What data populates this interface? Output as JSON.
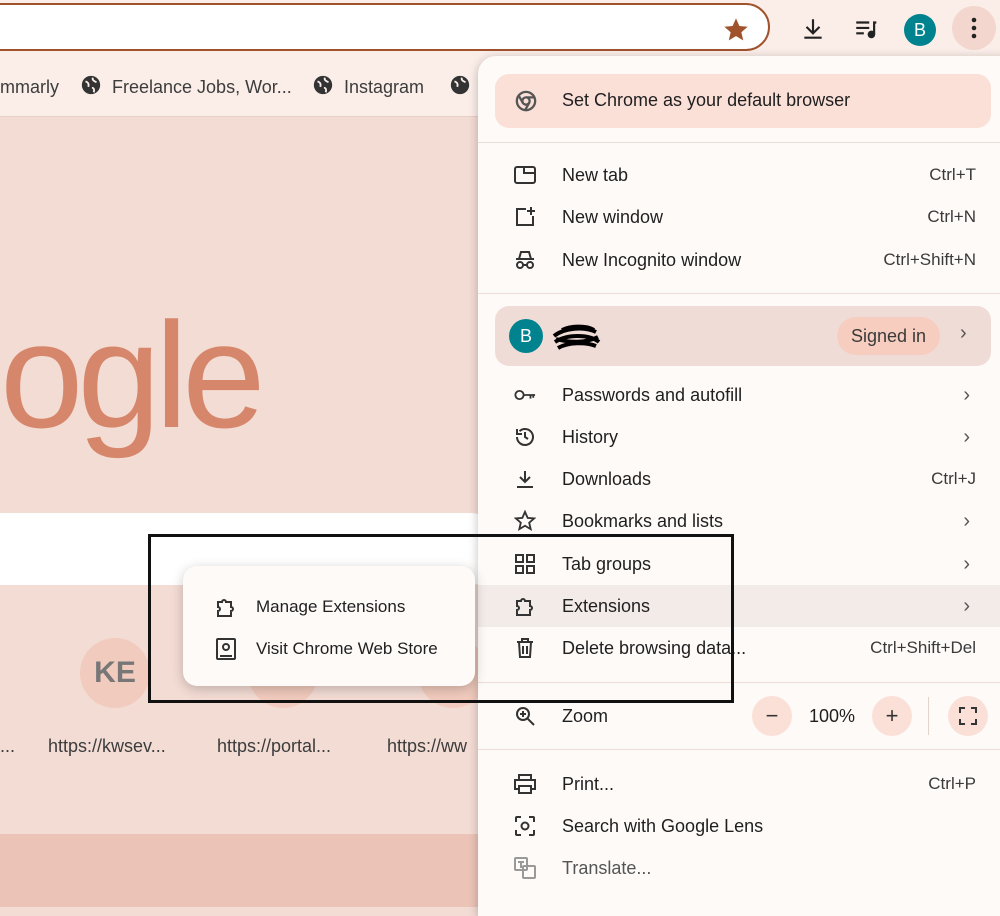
{
  "colors": {
    "accent": "#a0522d",
    "avatar": "#00838f",
    "menu_bg": "#fefaf8",
    "highlight": "#fbe0d8"
  },
  "toolbar": {
    "bookmark_star_icon": "star-icon",
    "download_icon": "download-icon",
    "media_icon": "playlist-icon",
    "avatar_letter": "B",
    "menu_icon": "three-dots-icon"
  },
  "bookmarks": [
    {
      "label": "mmarly",
      "icon": "globe-icon"
    },
    {
      "label": "Freelance Jobs, Wor...",
      "icon": "globe-icon"
    },
    {
      "label": "Instagram",
      "icon": "globe-icon"
    }
  ],
  "page": {
    "logo_text": "ogle",
    "shortcuts": [
      {
        "label": "...",
        "badge": ""
      },
      {
        "label": "https://kwsev...",
        "badge": "KE"
      },
      {
        "label": "https://portal...",
        "badge": ""
      },
      {
        "label": "https://ww",
        "badge": ""
      }
    ]
  },
  "menu": {
    "default_browser": "Set Chrome as your default browser",
    "new_tab": {
      "label": "New tab",
      "shortcut": "Ctrl+T"
    },
    "new_window": {
      "label": "New window",
      "shortcut": "Ctrl+N"
    },
    "incognito": {
      "label": "New Incognito window",
      "shortcut": "Ctrl+Shift+N"
    },
    "profile": {
      "avatar": "B",
      "status": "Signed in"
    },
    "passwords": {
      "label": "Passwords and autofill"
    },
    "history": {
      "label": "History"
    },
    "downloads": {
      "label": "Downloads",
      "shortcut": "Ctrl+J"
    },
    "bookmarks": {
      "label": "Bookmarks and lists"
    },
    "tab_groups": {
      "label": "Tab groups"
    },
    "extensions": {
      "label": "Extensions"
    },
    "delete_data": {
      "label": "Delete browsing data...",
      "shortcut": "Ctrl+Shift+Del"
    },
    "zoom": {
      "label": "Zoom",
      "minus": "−",
      "value": "100%",
      "plus": "+"
    },
    "print": {
      "label": "Print...",
      "shortcut": "Ctrl+P"
    },
    "lens": {
      "label": "Search with Google Lens"
    },
    "translate": {
      "label": "Translate..."
    }
  },
  "submenu": {
    "manage": "Manage Extensions",
    "webstore": "Visit Chrome Web Store"
  }
}
